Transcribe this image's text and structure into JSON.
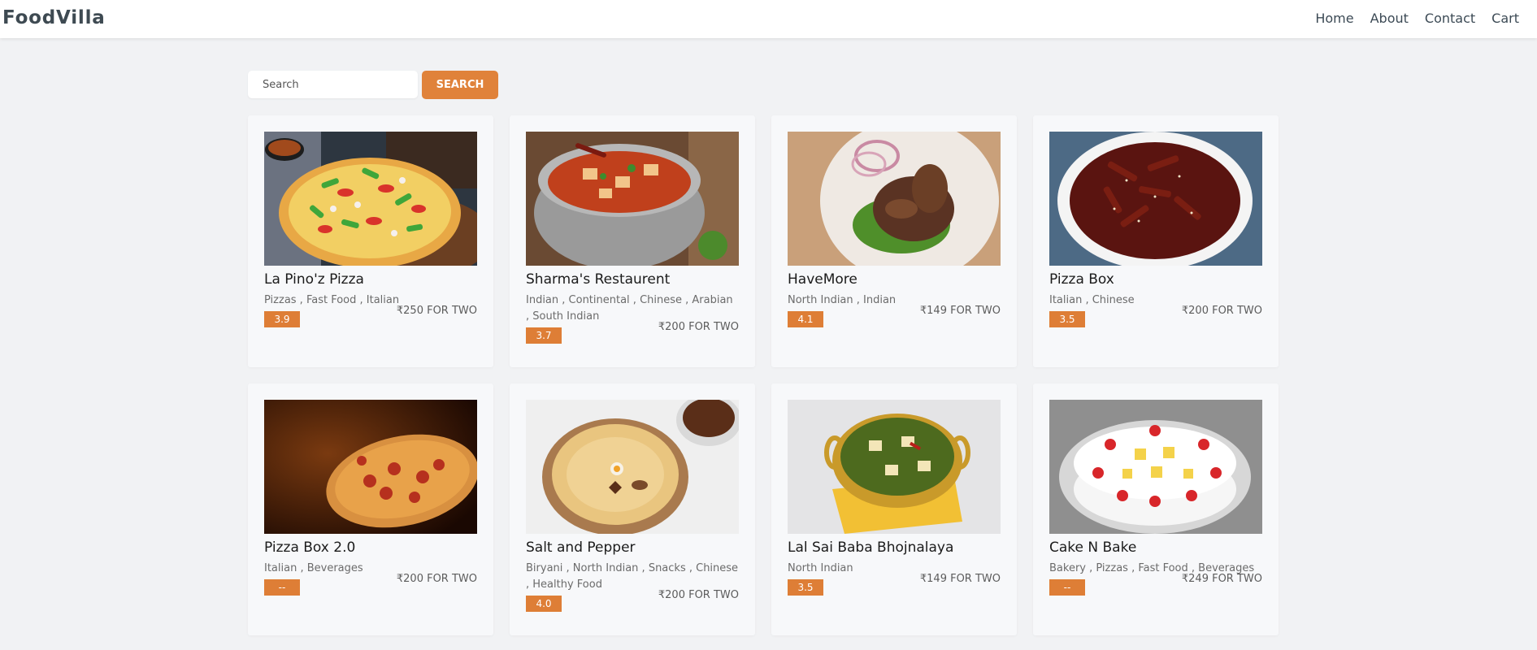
{
  "brand": {
    "logo": "FoodVilla"
  },
  "nav": [
    {
      "label": "Home"
    },
    {
      "label": "About"
    },
    {
      "label": "Contact"
    },
    {
      "label": "Cart"
    }
  ],
  "search": {
    "placeholder": "Search",
    "value": "",
    "button_label": "SEARCH"
  },
  "colors": {
    "accent": "#e0823a",
    "background": "#f1f2f4",
    "card": "#f7f8fa"
  },
  "restaurants": [
    {
      "name": "La Pino'z Pizza",
      "cuisines": "Pizzas , Fast Food , Italian",
      "rating": "3.9",
      "price": "₹250 FOR TWO",
      "image": "pizza"
    },
    {
      "name": "Sharma's Restaurent",
      "cuisines": "Indian , Continental , Chinese , Arabian , South Indian",
      "rating": "3.7",
      "price": "₹200 FOR TWO",
      "image": "paneer-curry"
    },
    {
      "name": "HaveMore",
      "cuisines": "North Indian , Indian",
      "rating": "4.1",
      "price": "₹149 FOR TWO",
      "image": "tandoori-chicken"
    },
    {
      "name": "Pizza Box",
      "cuisines": "Italian , Chinese",
      "rating": "3.5",
      "price": "₹200 FOR TWO",
      "image": "chilli-potato"
    },
    {
      "name": "Pizza Box 2.0",
      "cuisines": "Italian , Beverages",
      "rating": "--",
      "price": "₹200 FOR TWO",
      "image": "pepperoni-pizza"
    },
    {
      "name": "Salt and Pepper",
      "cuisines": "Biryani , North Indian , Snacks , Chinese , Healthy Food",
      "rating": "4.0",
      "price": "₹200 FOR TWO",
      "image": "biryani"
    },
    {
      "name": "Lal Sai Baba Bhojnalaya",
      "cuisines": "North Indian",
      "rating": "3.5",
      "price": "₹149 FOR TWO",
      "image": "palak-paneer"
    },
    {
      "name": "Cake N Bake",
      "cuisines": "Bakery , Pizzas , Fast Food , Beverages",
      "rating": "--",
      "price": "₹249 FOR TWO",
      "image": "pineapple-cake"
    }
  ]
}
